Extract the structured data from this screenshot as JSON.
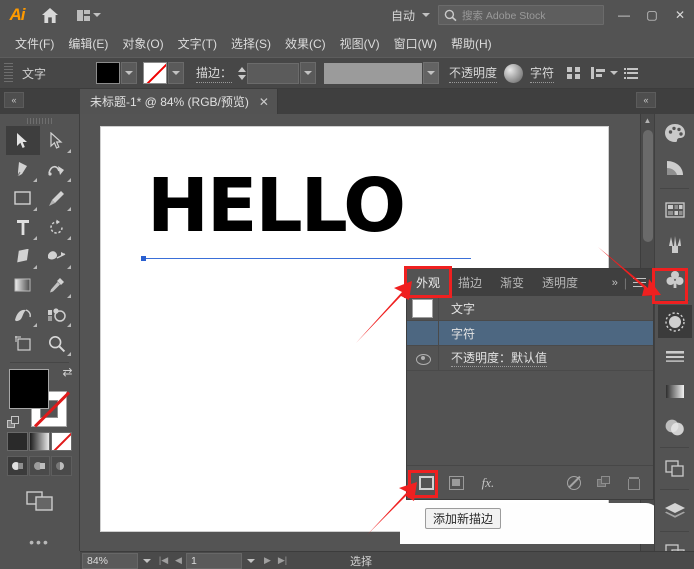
{
  "app": {
    "name": "Adobe Illustrator",
    "logo_text": "Ai"
  },
  "titlebar": {
    "home_icon": "home-icon",
    "arrange_icon": "arrange-documents-icon",
    "auto_label": "自动",
    "search_placeholder": "搜索 Adobe Stock",
    "search_icon": "search-icon",
    "minimize": "—",
    "maximize": "▢",
    "close": "✕"
  },
  "menubar": {
    "items": [
      {
        "label": "文件(F)"
      },
      {
        "label": "编辑(E)"
      },
      {
        "label": "对象(O)"
      },
      {
        "label": "文字(T)"
      },
      {
        "label": "选择(S)"
      },
      {
        "label": "效果(C)"
      },
      {
        "label": "视图(V)"
      },
      {
        "label": "窗口(W)"
      },
      {
        "label": "帮助(H)"
      }
    ]
  },
  "controlbar": {
    "context_label": "文字",
    "fill_swatch": "#000000",
    "stroke_swatch": "none",
    "stroke_label": "描边：",
    "stroke_weight": "",
    "stroke_profile": "",
    "opacity_label": "不透明度",
    "opacity_icon": "opacity-sphere-icon",
    "character_label": "字符",
    "align_icon": "align-icon",
    "distribute_icon": "distribute-icon",
    "options_icon": "more-options-icon"
  },
  "tabbar": {
    "collapse_left_icon": "collapse-left-icon",
    "collapse_right_icon": "collapse-right-icon",
    "document_title": "未标题-1* @ 84% (RGB/预览)",
    "close_glyph": "✕"
  },
  "toolbar": {
    "tools": [
      {
        "name": "selection-tool",
        "glyph": "arrow-solid",
        "selected": true,
        "has_flyout": false
      },
      {
        "name": "direct-selection-tool",
        "glyph": "arrow-hollow",
        "selected": false,
        "has_flyout": true
      },
      {
        "name": "pen-tool",
        "glyph": "pen",
        "selected": false,
        "has_flyout": true
      },
      {
        "name": "curvature-tool",
        "glyph": "curvature",
        "selected": false,
        "has_flyout": true
      },
      {
        "name": "rectangle-tool",
        "glyph": "rectangle",
        "selected": false,
        "has_flyout": true
      },
      {
        "name": "paintbrush-tool",
        "glyph": "brush",
        "selected": false,
        "has_flyout": true
      },
      {
        "name": "type-tool",
        "glyph": "type",
        "selected": false,
        "has_flyout": true
      },
      {
        "name": "rotate-tool",
        "glyph": "rotate",
        "selected": false,
        "has_flyout": true
      },
      {
        "name": "eraser-tool",
        "glyph": "eraser",
        "selected": false,
        "has_flyout": true
      },
      {
        "name": "shape-builder-tool",
        "glyph": "shape-builder",
        "selected": false,
        "has_flyout": true
      },
      {
        "name": "gradient-tool",
        "glyph": "gradient",
        "selected": false,
        "has_flyout": false
      },
      {
        "name": "eyedropper-tool",
        "glyph": "eyedropper",
        "selected": false,
        "has_flyout": true
      },
      {
        "name": "symbol-sprayer-tool",
        "glyph": "symbol-sprayer",
        "selected": false,
        "has_flyout": true
      },
      {
        "name": "graph-tool",
        "glyph": "graph",
        "selected": false,
        "has_flyout": true
      },
      {
        "name": "artboard-tool",
        "glyph": "artboard",
        "selected": false,
        "has_flyout": false
      },
      {
        "name": "zoom-tool",
        "glyph": "magnifier",
        "selected": false,
        "has_flyout": true
      }
    ],
    "fill_color": "#000000",
    "stroke_color": "none",
    "swap_icon": "swap-fill-stroke-icon",
    "default_icon": "default-fill-stroke-icon",
    "color_modes": [
      {
        "name": "color-mode-button",
        "type": "solid"
      },
      {
        "name": "gradient-mode-button",
        "type": "gradient"
      },
      {
        "name": "none-mode-button",
        "type": "none"
      }
    ],
    "draw_modes": [
      {
        "name": "draw-normal-button",
        "selected": true
      },
      {
        "name": "draw-behind-button",
        "selected": false
      },
      {
        "name": "draw-inside-button",
        "selected": false
      }
    ],
    "screen_mode_icon": "screen-mode-icon",
    "edit_toolbar_icon": "edit-toolbar-ellipsis-icon"
  },
  "canvas": {
    "artwork_text": "HELLO",
    "text_color": "#000000",
    "baseline_color": "#3a6fd8",
    "artboard_color": "#ffffff"
  },
  "panel": {
    "tabs": [
      {
        "label": "外观",
        "name": "tab-appearance",
        "active": true
      },
      {
        "label": "描边",
        "name": "tab-stroke",
        "active": false
      },
      {
        "label": "渐变",
        "name": "tab-gradient",
        "active": false
      },
      {
        "label": "透明度",
        "name": "tab-transparency",
        "active": false
      }
    ],
    "overflow_glyph": "»",
    "menu_icon": "panel-menu-icon",
    "rows": [
      {
        "label": "文字",
        "name": "appearance-row-type",
        "has_swatch": true,
        "swatch_color": "#ffffff",
        "has_eye": false,
        "selected": false,
        "dotted": false
      },
      {
        "label": "字符",
        "name": "appearance-row-characters",
        "has_swatch": false,
        "has_eye": false,
        "selected": true,
        "dotted": false
      },
      {
        "label": "不透明度：默认值",
        "name": "appearance-row-opacity",
        "has_swatch": false,
        "has_eye": true,
        "selected": false,
        "dotted": true
      }
    ],
    "footer_buttons": [
      {
        "name": "add-new-stroke-button",
        "icon": "square-outline-icon",
        "highlighted": true
      },
      {
        "name": "add-new-fill-button",
        "icon": "square-filled-icon",
        "highlighted": false
      },
      {
        "name": "add-new-effect-button",
        "icon": "fx-icon",
        "label": "fx.",
        "highlighted": false
      },
      {
        "name": "clear-appearance-button",
        "icon": "no-symbol-icon",
        "highlighted": false
      },
      {
        "name": "duplicate-item-button",
        "icon": "duplicate-icon",
        "highlighted": false
      },
      {
        "name": "delete-item-button",
        "icon": "trash-icon",
        "highlighted": false
      }
    ]
  },
  "tooltip": {
    "text": "添加新描边"
  },
  "rail": {
    "icons": [
      {
        "name": "rail-icon-color",
        "glyph": "palette",
        "selected": false,
        "sep_before": false
      },
      {
        "name": "rail-icon-color-guide",
        "glyph": "color-guide",
        "selected": false,
        "sep_before": false
      },
      {
        "name": "rail-icon-swatches",
        "glyph": "swatches",
        "selected": false,
        "sep_before": true
      },
      {
        "name": "rail-icon-brushes",
        "glyph": "brushes",
        "selected": false,
        "sep_before": false
      },
      {
        "name": "rail-icon-symbols",
        "glyph": "symbols",
        "selected": false,
        "sep_before": false
      },
      {
        "name": "rail-icon-appearance",
        "glyph": "appearance",
        "selected": true,
        "sep_before": true
      },
      {
        "name": "rail-icon-stroke",
        "glyph": "stroke",
        "selected": false,
        "sep_before": false
      },
      {
        "name": "rail-icon-gradient",
        "glyph": "gradient",
        "selected": false,
        "sep_before": false
      },
      {
        "name": "rail-icon-transparency",
        "glyph": "transparency",
        "selected": false,
        "sep_before": false
      },
      {
        "name": "rail-icon-pathfinder",
        "glyph": "pathfinder",
        "selected": false,
        "sep_before": true
      },
      {
        "name": "rail-icon-layers",
        "glyph": "layers",
        "selected": false,
        "sep_before": true
      },
      {
        "name": "rail-icon-artboards",
        "glyph": "artboards",
        "selected": false,
        "sep_before": true
      }
    ]
  },
  "statusbar": {
    "zoom_value": "84%",
    "page_value": "1",
    "status_text": "选择",
    "first_page_icon": "first-page-icon",
    "prev_page_icon": "prev-page-icon",
    "next_page_icon": "next-page-icon",
    "last_page_icon": "last-page-icon"
  },
  "annotations": {
    "highlight_color": "#ef2020",
    "boxes": [
      {
        "name": "highlight-appearance-tab"
      },
      {
        "name": "highlight-rail-appearance-icon"
      },
      {
        "name": "highlight-add-new-stroke-button"
      }
    ],
    "arrows": [
      {
        "name": "arrow-to-appearance-tab"
      },
      {
        "name": "arrow-to-rail-appearance-icon"
      },
      {
        "name": "arrow-to-add-new-stroke-button"
      }
    ]
  }
}
